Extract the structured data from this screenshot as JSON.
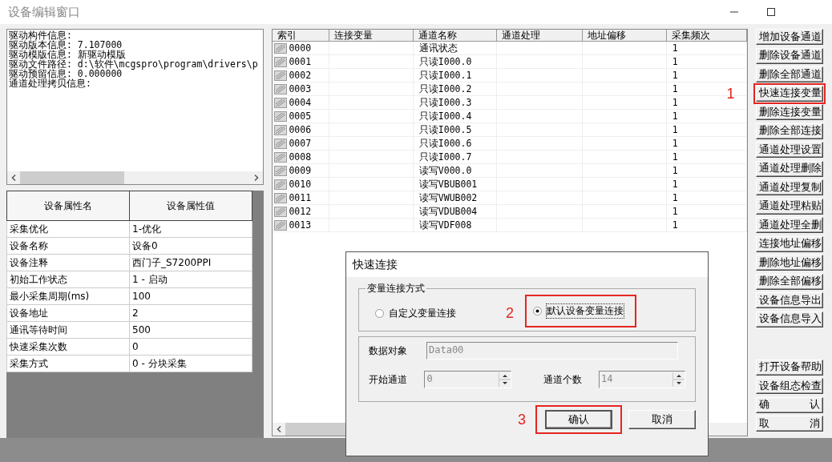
{
  "window": {
    "title": "设备编辑窗口"
  },
  "driver_info": [
    "驱动构件信息:",
    "驱动版本信息: 7.107000",
    "驱动模版信息: 新驱动模版",
    "驱动文件路径: d:\\软件\\mcgspro\\program\\drivers\\p",
    "驱动预留信息: 0.000000",
    "通道处理拷贝信息:"
  ],
  "properties": {
    "columns": [
      "设备属性名",
      "设备属性值"
    ],
    "rows": [
      [
        "采集优化",
        "1-优化"
      ],
      [
        "设备名称",
        "设备0"
      ],
      [
        "设备注释",
        "西门子_S7200PPI"
      ],
      [
        "初始工作状态",
        "1 - 启动"
      ],
      [
        "最小采集周期(ms)",
        "100"
      ],
      [
        "设备地址",
        "2"
      ],
      [
        "通讯等待时间",
        "500"
      ],
      [
        "快速采集次数",
        "0"
      ],
      [
        "采集方式",
        "0 - 分块采集"
      ]
    ]
  },
  "channels": {
    "columns": [
      "索引",
      "连接变量",
      "通道名称",
      "通道处理",
      "地址偏移",
      "采集频次"
    ],
    "rows": [
      [
        "0000",
        "",
        "通讯状态",
        "",
        "",
        "1"
      ],
      [
        "0001",
        "",
        "只读I000.0",
        "",
        "",
        "1"
      ],
      [
        "0002",
        "",
        "只读I000.1",
        "",
        "",
        "1"
      ],
      [
        "0003",
        "",
        "只读I000.2",
        "",
        "",
        "1"
      ],
      [
        "0004",
        "",
        "只读I000.3",
        "",
        "",
        "1"
      ],
      [
        "0005",
        "",
        "只读I000.4",
        "",
        "",
        "1"
      ],
      [
        "0006",
        "",
        "只读I000.5",
        "",
        "",
        "1"
      ],
      [
        "0007",
        "",
        "只读I000.6",
        "",
        "",
        "1"
      ],
      [
        "0008",
        "",
        "只读I000.7",
        "",
        "",
        "1"
      ],
      [
        "0009",
        "",
        "读写V000.0",
        "",
        "",
        "1"
      ],
      [
        "0010",
        "",
        "读写VBUB001",
        "",
        "",
        "1"
      ],
      [
        "0011",
        "",
        "读写VWUB002",
        "",
        "",
        "1"
      ],
      [
        "0012",
        "",
        "读写VDUB004",
        "",
        "",
        "1"
      ],
      [
        "0013",
        "",
        "读写VDF008",
        "",
        "",
        "1"
      ]
    ]
  },
  "side_buttons": {
    "top": [
      {
        "label": "增加设备通道"
      },
      {
        "label": "删除设备通道"
      },
      {
        "label": "删除全部通道"
      },
      {
        "label": "快速连接变量",
        "marker": "1"
      },
      {
        "label": "删除连接变量"
      },
      {
        "label": "删除全部连接"
      },
      {
        "label": "通道处理设置"
      },
      {
        "label": "通道处理删除"
      },
      {
        "label": "通道处理复制"
      },
      {
        "label": "通道处理粘贴"
      },
      {
        "label": "通道处理全删"
      },
      {
        "label": "连接地址偏移"
      },
      {
        "label": "删除地址偏移"
      },
      {
        "label": "删除全部偏移"
      },
      {
        "label": "设备信息导出"
      },
      {
        "label": "设备信息导入"
      }
    ],
    "bottom": [
      {
        "label": "打开设备帮助"
      },
      {
        "label": "设备组态检查"
      },
      {
        "label": "确 认"
      },
      {
        "label": "取 消"
      }
    ]
  },
  "dialog": {
    "title": "快速连接",
    "group_label": "变量连接方式",
    "radios": [
      {
        "label": "自定义变量连接",
        "selected": false
      },
      {
        "label": "默认设备变量连接",
        "selected": true,
        "marker": "2"
      }
    ],
    "data_object": {
      "label": "数据对象",
      "value": "Data00"
    },
    "start_channel": {
      "label": "开始通道",
      "value": "0"
    },
    "channel_count": {
      "label": "通道个数",
      "value": "14"
    },
    "buttons": [
      {
        "label": "确认",
        "marker": "3"
      },
      {
        "label": "取消"
      }
    ]
  }
}
